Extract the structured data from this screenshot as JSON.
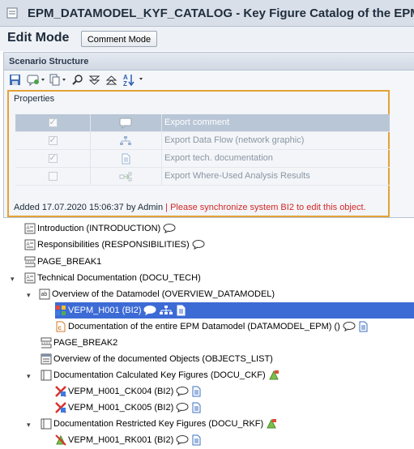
{
  "window": {
    "title": "EPM_DATAMODEL_KYF_CATALOG - Key Figure Catalog of the EPM D"
  },
  "editbar": {
    "mode_label": "Edit Mode",
    "comment_mode_button": "Comment Mode"
  },
  "scenario": {
    "panel_title": "Scenario Structure"
  },
  "toolbar": {
    "icons": [
      "save-icon",
      "comment-dropdown-icon",
      "copy-dropdown-icon",
      "find-icon",
      "expand-all-icon",
      "collapse-all-icon",
      "sort-dropdown-icon"
    ]
  },
  "properties": {
    "label": "Properties",
    "rows": [
      {
        "checked": true,
        "icon": "comment-icon",
        "label": "Export comment",
        "selected": true
      },
      {
        "checked": true,
        "icon": "network-graphic-icon",
        "label": "Export Data Flow (network graphic)",
        "selected": false
      },
      {
        "checked": true,
        "icon": "document-icon",
        "label": "Export tech. documentation",
        "selected": false
      },
      {
        "checked": false,
        "icon": "where-used-icon",
        "label": "Export Where-Used Analysis Results",
        "selected": false
      }
    ],
    "added_text": "Added 17.07.2020 15:06:37 by Admin",
    "separator": "|",
    "warning_text": "Please synchronize system BI2 to edit this object."
  },
  "tree": {
    "nodes": [
      {
        "label": "Introduction (INTRODUCTION)",
        "icon": "text-doc-icon",
        "comment": true
      },
      {
        "label": "Responsibilities (RESPONSIBILITIES)",
        "icon": "text-doc-icon",
        "comment": true
      },
      {
        "label": "PAGE_BREAK1",
        "icon": "page-break-icon"
      },
      {
        "label": "Technical Documentation (DOCU_TECH)",
        "icon": "text-doc-icon",
        "expanded": true
      },
      {
        "label": "Overview of the Datamodel (OVERVIEW_DATAMODEL)",
        "icon": "ab-doc-icon",
        "expanded": true
      },
      {
        "label": "VEPM_H001 (BI2)",
        "icon": "multiprovider-icon",
        "selected": true
      },
      {
        "label": "Documentation of the entire EPM Datamodel (DATAMODEL_EPM) ()",
        "icon": "datamodel-icon"
      },
      {
        "label": "PAGE_BREAK2",
        "icon": "page-break-icon"
      },
      {
        "label": "Overview of the documented Objects (OBJECTS_LIST)",
        "icon": "list-icon"
      },
      {
        "label": "Documentation Calculated Key Figures (DOCU_CKF)",
        "icon": "frame-icon",
        "expanded": true
      },
      {
        "label": "VEPM_H001_CK004 (BI2)",
        "icon": "calc-kyf-icon"
      },
      {
        "label": "VEPM_H001_CK005 (BI2)",
        "icon": "calc-kyf-icon"
      },
      {
        "label": "Documentation Restricted Key Figures (DOCU_RKF)",
        "icon": "frame-icon",
        "expanded": true
      },
      {
        "label": "VEPM_H001_RK001 (BI2)",
        "icon": "restricted-kyf-icon"
      }
    ]
  }
}
